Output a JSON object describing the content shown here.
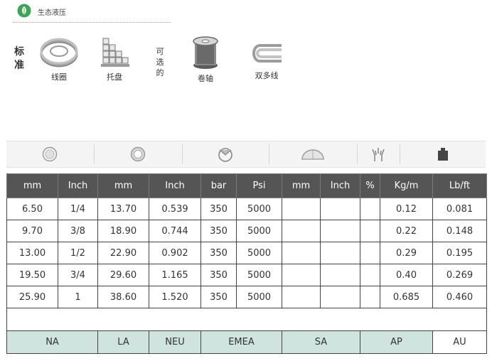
{
  "brand": {
    "name": "生态液压"
  },
  "side_labels": {
    "standard": "标准",
    "optional": "可选的"
  },
  "products": [
    {
      "label": "线圈",
      "icon": "hose-coil-icon"
    },
    {
      "label": "托盘",
      "icon": "pallet-icon"
    },
    {
      "label": "卷轴",
      "icon": "reel-icon"
    },
    {
      "label": "双多线",
      "icon": "twin-line-icon"
    }
  ],
  "icon_header": [
    "inner-diameter-icon",
    "outer-diameter-icon",
    "working-pressure-icon",
    "bend-radius-icon",
    "burst-icon",
    "weight-icon"
  ],
  "table": {
    "headers": [
      "mm",
      "Inch",
      "mm",
      "Inch",
      "bar",
      "Psi",
      "mm",
      "Inch",
      "%",
      "Kg/m",
      "Lb/ft"
    ],
    "rows": [
      [
        "6.50",
        "1/4",
        "13.70",
        "0.539",
        "350",
        "5000",
        "",
        "",
        "",
        "0.12",
        "0.081"
      ],
      [
        "9.70",
        "3/8",
        "18.90",
        "0.744",
        "350",
        "5000",
        "",
        "",
        "",
        "0.22",
        "0.148"
      ],
      [
        "13.00",
        "1/2",
        "22.90",
        "0.902",
        "350",
        "5000",
        "",
        "",
        "",
        "0.29",
        "0.195"
      ],
      [
        "19.50",
        "3/4",
        "29.60",
        "1.165",
        "350",
        "5000",
        "",
        "",
        "",
        "0.40",
        "0.269"
      ],
      [
        "25.90",
        "1",
        "38.60",
        "1.520",
        "350",
        "5000",
        "",
        "",
        "",
        "0.685",
        "0.460"
      ]
    ],
    "regions": [
      "NA",
      "LA",
      "NEU",
      "EMEA",
      "SA",
      "AP",
      "AU"
    ]
  },
  "colors": {
    "header_bg": "#555555",
    "region_bg": "#cfe3df",
    "brand_green": "#3aa655"
  }
}
